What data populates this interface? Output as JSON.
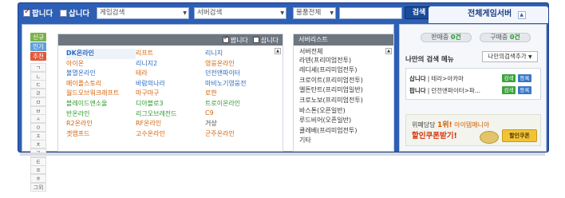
{
  "topbar": {
    "sell_label": "팝니다",
    "buy_label": "삽니다",
    "game_search": "게임검색",
    "server_search": "서버검색",
    "item_category": "물품전체",
    "search_value": "",
    "search_button": "검색",
    "server_tab": "전체게임서버"
  },
  "left": {
    "side_tabs": [
      "신규",
      "인기",
      "추천"
    ],
    "consonants": [
      "ㄱ",
      "ㄴ",
      "ㄷ",
      "ㄹ",
      "ㅁ",
      "ㅂ",
      "ㅅ",
      "ㅇ",
      "ㅈ",
      "ㅊ",
      "ㅋ",
      "ㅌ",
      "ㅍ",
      "ㅎ",
      "그외"
    ],
    "game_header": {
      "sell": "팝니다",
      "buy": "삽니다"
    },
    "games": [
      [
        "DK온라인",
        "리프트",
        "리니지"
      ],
      [
        "아이온",
        "리니지2",
        "영웅온라인"
      ],
      [
        "불멸온라인",
        "테라",
        "던전앤파이터"
      ],
      [
        "메이플스토리",
        "바람의나라",
        "마비노기영웅전"
      ],
      [
        "월드오브워크래프트",
        "마구마구",
        "로한"
      ],
      [
        "블레이드앤소울",
        "디아블로3",
        "트로이온라인"
      ],
      [
        "반온라인",
        "리그오브레전드",
        "C9"
      ],
      [
        "R2온라인",
        "RF온라인",
        "거상"
      ],
      [
        "겟앰프드",
        "고수온라인",
        "군주온라인"
      ]
    ],
    "server_header": "서버리스트",
    "servers": [
      "서버전체",
      "라덴(프리미엄전투)",
      "레디셰(프리미엄전투)",
      "크로이트(프리미엄전투)",
      "엘튼탄트(프리미엄일반)",
      "크로노보(프리미엄전투)",
      "바스톤(오픈일반)",
      "루드비어(오픈일반)",
      "쿨레베(프리미엄전투)",
      "기타"
    ]
  },
  "right": {
    "selling": {
      "label": "판매중",
      "count": "0건"
    },
    "buying": {
      "label": "구매중",
      "count": "0건"
    },
    "my_search_title": "나만의 검색 메뉴",
    "my_search_add": "나만의검색추가",
    "saved": [
      {
        "type": "삽니다",
        "path": "테라>아카마",
        "search": "검색",
        "register": "등록"
      },
      {
        "type": "팝니다",
        "path": "던전앤파이터>파...",
        "search": "검색",
        "register": "등록"
      }
    ],
    "banner": {
      "prefix": "위폐당당",
      "rank": "1위!",
      "brand": "아이템매니아",
      "headline": "할인쿠폰받기!",
      "coupon": "할인쿠폰"
    }
  },
  "colors": {
    "frame": "#2c5fb5",
    "new": "#7bb24a",
    "popular": "#5fa0dc",
    "recommend": "#e05a3a",
    "search_green": "#3aa53a",
    "register_blue": "#3a78c8"
  }
}
